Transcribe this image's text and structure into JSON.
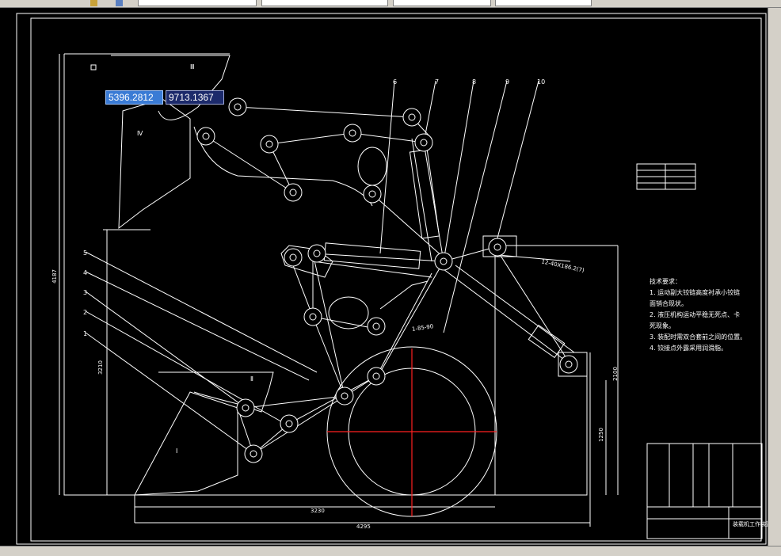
{
  "coordinate_tooltip": {
    "x_value": "5396.2812",
    "y_value": "9713.1367"
  },
  "part_labels": [
    "1",
    "2",
    "3",
    "4",
    "5",
    "6",
    "7",
    "8",
    "9",
    "10"
  ],
  "roman_labels": {
    "top": "Ⅲ",
    "left": "Ⅳ",
    "bottom": "Ⅱ",
    "bucket": "Ⅰ"
  },
  "dimensions": {
    "height_total": "4187",
    "height_mid": "3210",
    "height_right": "2100",
    "height_small": "1250",
    "width_base": "3230",
    "width_total": "4295",
    "angle_note": "12-40X186.2(7)",
    "small_note": "1-85-90"
  },
  "technical_requirements": {
    "title": "技术要求：",
    "lines": [
      "1. 运动副大铰链高度衬承小铰链",
      "   面销合现状。",
      "2. 液压机构运动平稳无死点、卡",
      "   死现象。",
      "3. 装配时需双合套前之间的位置。",
      "4. 铰接点外露采用润滑脂。"
    ]
  },
  "title_block": {
    "name": "装载机工作装置"
  },
  "colors": {
    "lines": "#ffffff",
    "centerline": "#ff2020",
    "tooltip_x": "#3a7bd5",
    "tooltip_y": "#1c2a6b"
  }
}
